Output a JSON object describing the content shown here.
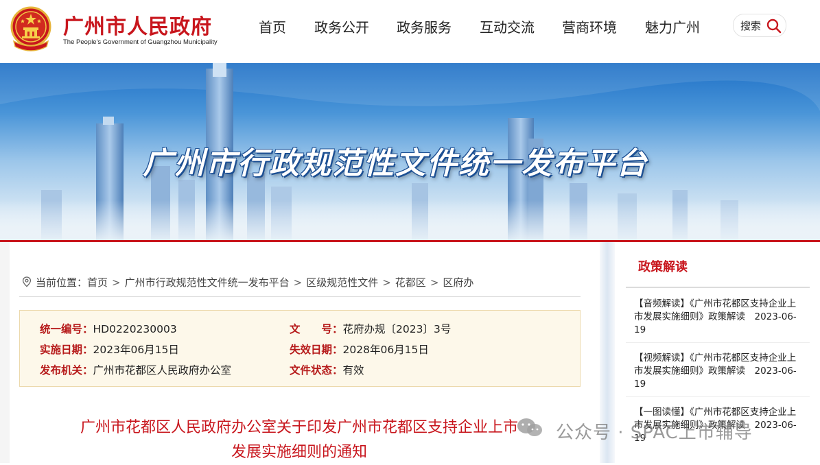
{
  "header": {
    "brand_cn": "广州市人民政府",
    "brand_en": "The People's Government of Guangzhou Municipality",
    "nav": [
      "首页",
      "政务公开",
      "政务服务",
      "互动交流",
      "营商环境",
      "魅力广州"
    ],
    "search_label": "搜索"
  },
  "banner": {
    "title": "广州市行政规范性文件统一发布平台"
  },
  "breadcrumb": {
    "prefix": "当前位置：",
    "items": [
      "首页",
      "广州市行政规范性文件统一发布平台",
      "区级规范性文件",
      "花都区",
      "区府办"
    ],
    "separator": ">"
  },
  "meta": {
    "number_key": "统一编号：",
    "number_val": "HD0220230003",
    "doc_key": "文　　号：",
    "doc_val": "花府办规〔2023〕3号",
    "start_key": "实施日期：",
    "start_val": "2023年06月15日",
    "end_key": "失效日期：",
    "end_val": "2028年06月15日",
    "issuer_key": "发布机关：",
    "issuer_val": "广州市花都区人民政府办公室",
    "status_key": "文件状态：",
    "status_val": "有效"
  },
  "doc_title": {
    "line1": "广州市花都区人民政府办公室关于印发广州市花都区支持企业上市",
    "line2": "发展实施细则的通知"
  },
  "sidebar": {
    "title": "政策解读",
    "items": [
      "【音频解读】《广州市花都区支持企业上市发展实施细则》政策解读　2023-06-19",
      "【视频解读】《广州市花都区支持企业上市发展实施细则》政策解读　2023-06-19",
      "【一图读懂】《广州市花都区支持企业上市发展实施细则》政策解读　2023-06-19"
    ]
  },
  "watermark": {
    "text": "公众号 · SPAC上市辅导"
  },
  "colors": {
    "brand_red": "#c8161d",
    "meta_bg": "#fdf8ea",
    "meta_border": "#ecd9ac"
  }
}
